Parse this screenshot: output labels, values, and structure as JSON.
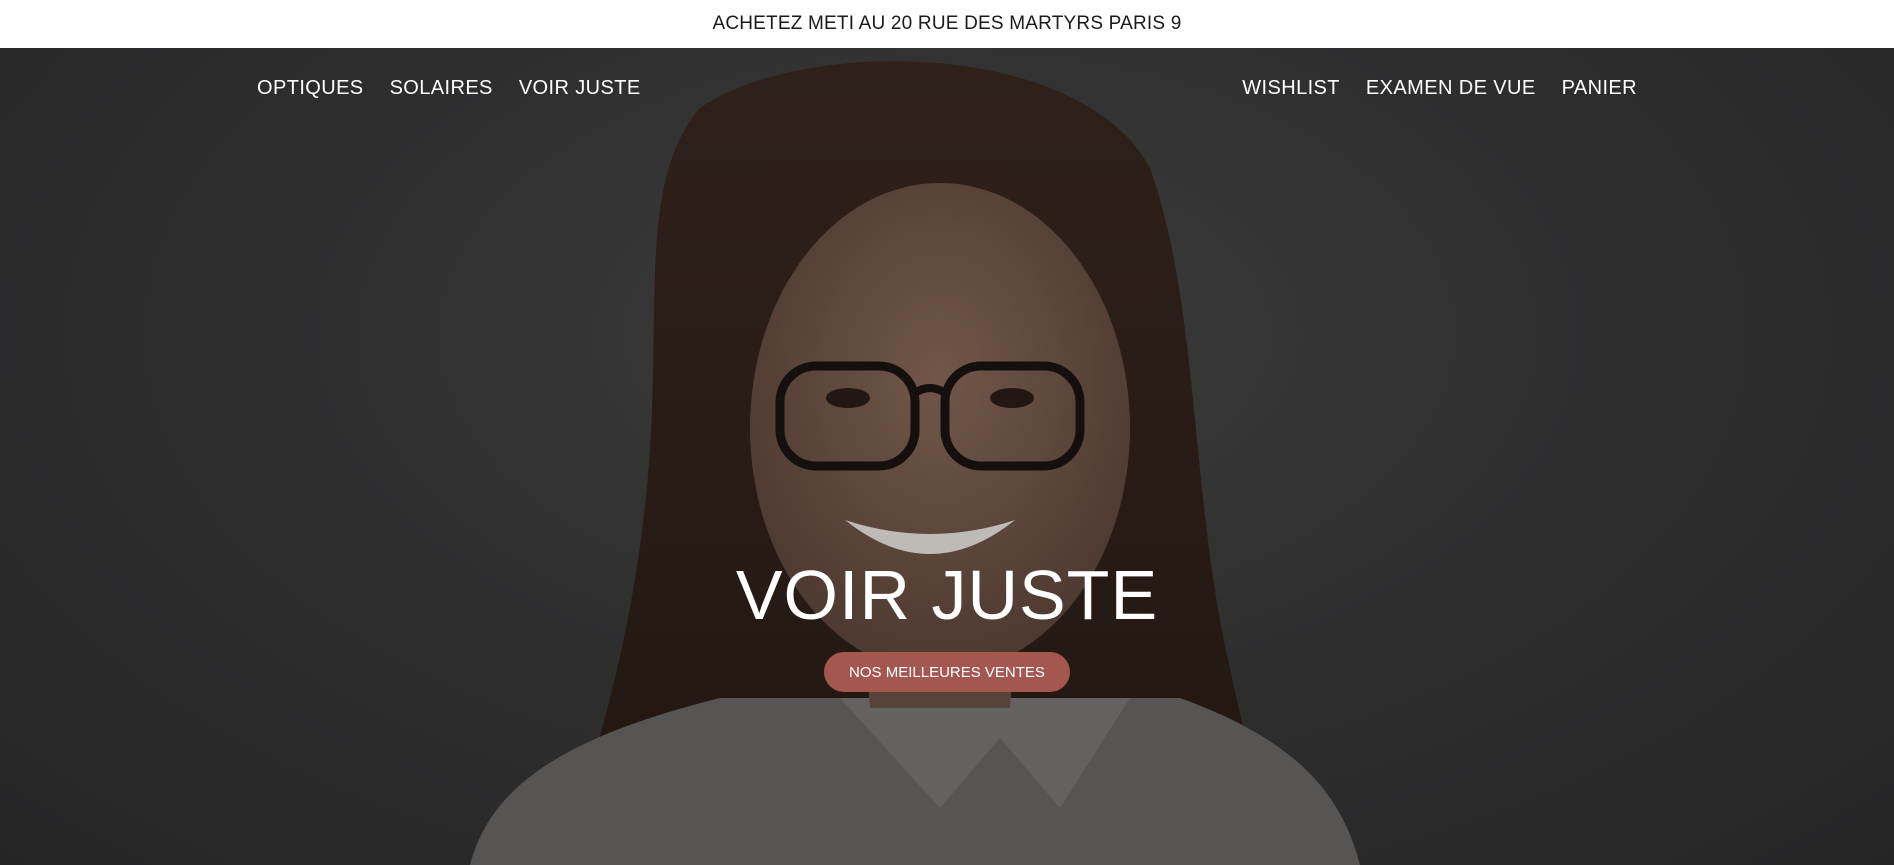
{
  "announcement": {
    "text": "ACHETEZ METI AU 20 RUE DES MARTYRS PARIS 9"
  },
  "nav": {
    "left": [
      "OPTIQUES",
      "SOLAIRES",
      "VOIR JUSTE"
    ],
    "right": [
      "WISHLIST",
      "EXAMEN DE VUE",
      "PANIER"
    ]
  },
  "hero": {
    "title": "VOIR JUSTE",
    "cta_label": "NOS MEILLEURES VENTES"
  },
  "colors": {
    "cta_background": "#a4574f",
    "hero_background": "#3a3a3b",
    "announcement_background": "#ffffff"
  }
}
